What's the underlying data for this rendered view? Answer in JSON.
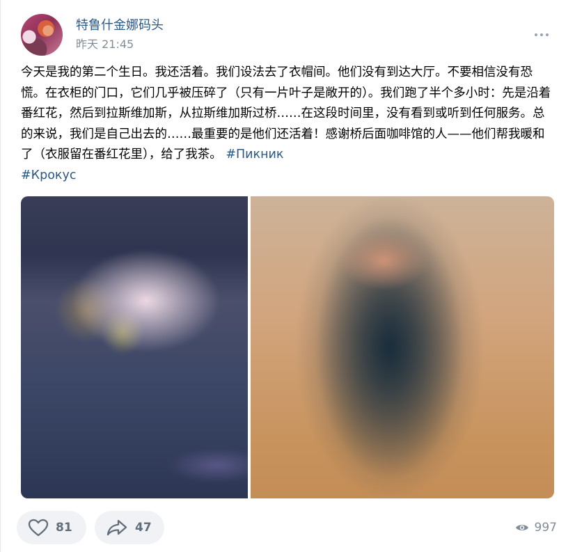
{
  "author": {
    "name": "特鲁什金娜码头",
    "time": "昨天 21:45"
  },
  "post": {
    "text": "今天是我的第二个生日。我还活着。我们设法去了衣帽间。他们没有到达大厅。不要相信没有恐慌。在衣柜的门口，它们几乎被压碎了（只有一片叶子是敞开的）。我们跑了半个多小时：先是沿着番红花，然后到拉斯维加斯，从拉斯维加斯过桥……在这段时间里，没有看到或听到任何服务。总的来说，我们是自己出去的……最重要的是他们还活着！感谢桥后面咖啡馆的人——他们帮我暖和了（衣服留在番红花里），给了我茶。",
    "hashtags": [
      "#Пикник",
      "#Крокус"
    ]
  },
  "footer": {
    "likes": "81",
    "shares": "47",
    "views": "997"
  },
  "icons": {
    "like": "heart-outline-icon",
    "share": "share-arrow-icon",
    "views": "eye-icon",
    "more": "more-horizontal-icon"
  },
  "colors": {
    "link": "#2a5885",
    "secondary": "#818c99",
    "pill_bg": "#f0f2f5",
    "icon": "#626d7a"
  }
}
